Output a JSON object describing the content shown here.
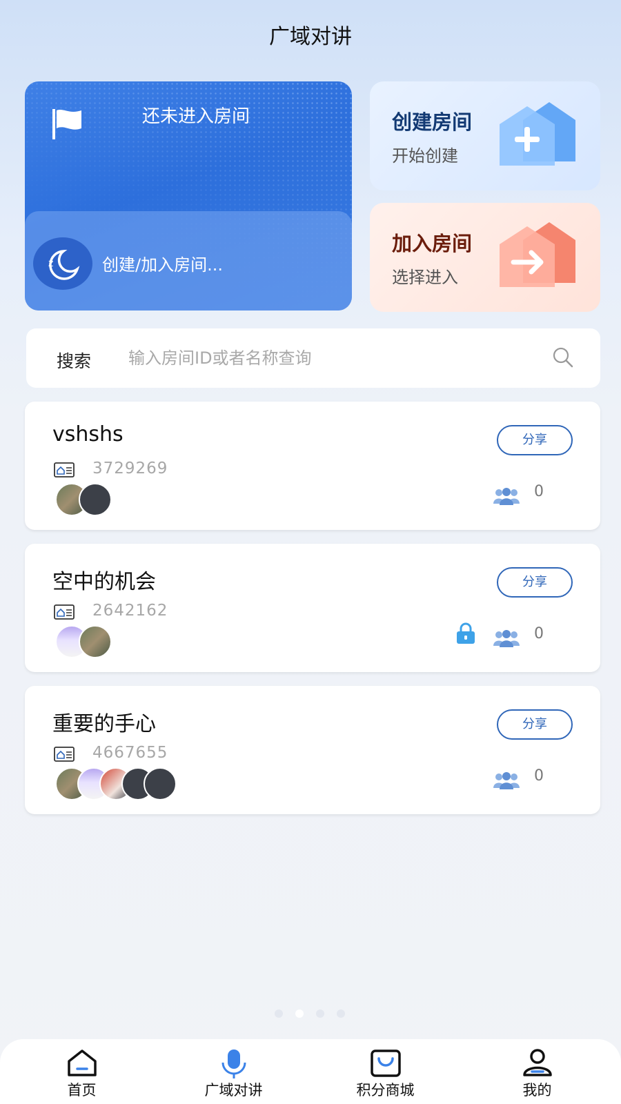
{
  "header": {
    "title": "广域对讲"
  },
  "status_card": {
    "title": "还未进入房间",
    "hint": "创建/加入房间..."
  },
  "actions": {
    "create": {
      "title": "创建房间",
      "subtitle": "开始创建",
      "title_color": "#133a73"
    },
    "join": {
      "title": "加入房间",
      "subtitle": "选择进入",
      "title_color": "#6b1d0c"
    }
  },
  "search": {
    "label": "搜索",
    "placeholder": "输入房间ID或者名称查询",
    "value": ""
  },
  "rooms": [
    {
      "name": "vshshs",
      "id": "3729269",
      "share_label": "分享",
      "member_count": "0",
      "locked": false
    },
    {
      "name": "空中的机会",
      "id": "2642162",
      "share_label": "分享",
      "member_count": "0",
      "locked": true
    },
    {
      "name": "重要的手心",
      "id": "4667655",
      "share_label": "分享",
      "member_count": "0",
      "locked": false
    }
  ],
  "pager": {
    "total": 4,
    "active_index": 1
  },
  "tabbar": {
    "items": [
      {
        "label": "首页",
        "icon": "home-icon",
        "active": false
      },
      {
        "label": "广域对讲",
        "icon": "microphone-icon",
        "active": true
      },
      {
        "label": "积分商城",
        "icon": "shopping-bag-icon",
        "active": false
      },
      {
        "label": "我的",
        "icon": "user-icon",
        "active": false
      }
    ]
  },
  "colors": {
    "accent": "#3b82e8",
    "share_border": "#2f66b8",
    "lock": "#3ea2e8"
  }
}
